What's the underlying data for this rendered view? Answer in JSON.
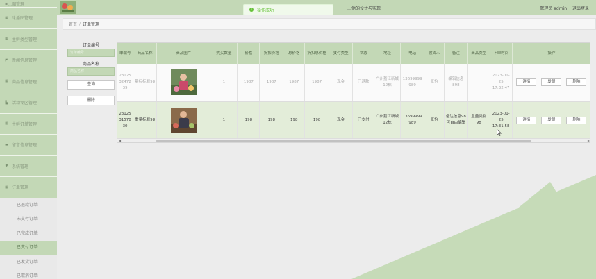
{
  "header": {
    "toast": "操作成功",
    "system_title": "…他的设计与实现",
    "user_label": "管理员 admin",
    "logout": "退出登录"
  },
  "breadcrumb": {
    "home": "首页",
    "separator": "/",
    "current": "订单管理"
  },
  "sidebar": {
    "top_item": "…图管理",
    "items": [
      {
        "label": "轮播图管理",
        "icon": "grid-icon"
      },
      {
        "label": "生鲜类型管理",
        "icon": "grid-icon"
      },
      {
        "label": "新闻信息管理",
        "icon": "megaphone-icon"
      },
      {
        "label": "商品信息管理",
        "icon": "grid-icon"
      },
      {
        "label": "活动专区管理",
        "icon": "chart-icon"
      },
      {
        "label": "生鲜订单管理",
        "icon": "grid-icon"
      },
      {
        "label": "留言信息管理",
        "icon": "message-icon"
      },
      {
        "label": "系统管理",
        "icon": "gear-icon"
      },
      {
        "label": "订单管理",
        "icon": "grid-icon"
      }
    ],
    "sub_items": [
      {
        "label": "已退款订单"
      },
      {
        "label": "未支付订单"
      },
      {
        "label": "已完成订单"
      },
      {
        "label": "已支付订单"
      },
      {
        "label": "已发货订单"
      },
      {
        "label": "已取消订单"
      }
    ]
  },
  "search": {
    "order_no_label": "订单编号",
    "order_no_placeholder": "订单编号",
    "product_name_label": "商品名称",
    "product_name_placeholder": "商品名称",
    "query_button": "查询",
    "delete_button": "删除"
  },
  "table": {
    "columns": [
      "单编号",
      "商品名称",
      "商品图片",
      "购买数量",
      "价格",
      "折扣价格",
      "总价格",
      "折扣总价格",
      "支付类型",
      "状态",
      "地址",
      "电话",
      "收货人",
      "备注",
      "商品类型",
      "下单时间",
      "操作"
    ],
    "rows": [
      {
        "order_no": "231253247239",
        "name": "量标标题98",
        "qty": "1",
        "price": "1987",
        "discount_price": "1987",
        "total": "1987",
        "discount_total": "1987",
        "pay_type": "现金",
        "status": "已退款",
        "address": "广州荔江新城12栋",
        "phone": "13699999989",
        "receiver": "张怡",
        "remark": "编辑信息 898",
        "type": "",
        "time": "2023-01-25 17:32:47",
        "buttons": [
          "详情",
          "发货",
          "删除"
        ]
      },
      {
        "order_no": "2312531578 30",
        "name": "重量标题98",
        "qty": "1",
        "price": "198",
        "discount_price": "198",
        "total": "198",
        "discount_total": "198",
        "pay_type": "现金",
        "status": "已支付",
        "address": "广州荔江新城12栋",
        "phone": "13699999989",
        "receiver": "张怡",
        "remark": "备注信息98可自由编辑",
        "type": "重量类别98",
        "time": "2023-01-25 17:31:58",
        "buttons": [
          "详情",
          "发货",
          "删除"
        ]
      }
    ]
  },
  "colors": {
    "accent": "#c3d8b6",
    "accent_dark": "#4f6346",
    "success": "#67c23a",
    "decor": "#c6dbb8"
  }
}
